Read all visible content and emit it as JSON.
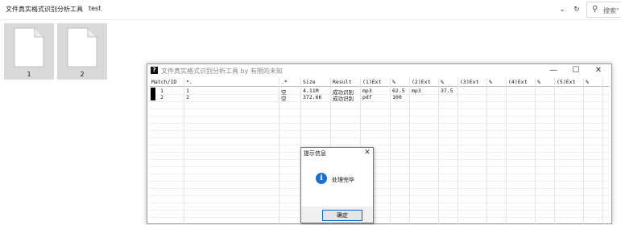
{
  "explorer": {
    "breadcrumb": [
      "文件真实格式识别分析工具",
      "test"
    ],
    "separator": "›",
    "dropdown_glyph": "⌄",
    "refresh_glyph": "↻",
    "search_placeholder": "搜索\""
  },
  "files": [
    {
      "name": "1",
      "icon": "blank-file-icon"
    },
    {
      "name": "2",
      "icon": "blank-file-icon"
    }
  ],
  "app": {
    "icon_glyph": "?",
    "title": "文件真实格式识别分析工具 by 有限的未知",
    "window_buttons": {
      "minimize": "—",
      "maximize": "☐",
      "close": "✕"
    },
    "columns": [
      "Match/ID",
      "*.",
      ".*",
      "Size",
      "Result",
      "(1)Ext",
      "%",
      "(2)Ext",
      "%",
      "(3)Ext",
      "%",
      "(4)Ext",
      "%",
      "(5)Ext",
      "%"
    ],
    "rows": [
      [
        "1",
        "1",
        "空",
        "4.11M",
        "成功识别",
        "mp3",
        "62.5",
        "mp3",
        "37.5",
        "",
        "",
        "",
        "",
        "",
        ""
      ],
      [
        "2",
        "2",
        "空",
        "372.6K",
        "成功识别",
        "pdf",
        "100",
        "",
        "",
        "",
        "",
        "",
        "",
        "",
        ""
      ]
    ]
  },
  "dialog": {
    "title": "提示信息",
    "close_glyph": "✕",
    "icon_glyph": "i",
    "message": "处理完毕",
    "ok_label": "确定"
  },
  "colors": {
    "accent": "#0a64d6",
    "info_icon": "#1e6fd0",
    "file_tile_bg": "#d9d9d9"
  }
}
